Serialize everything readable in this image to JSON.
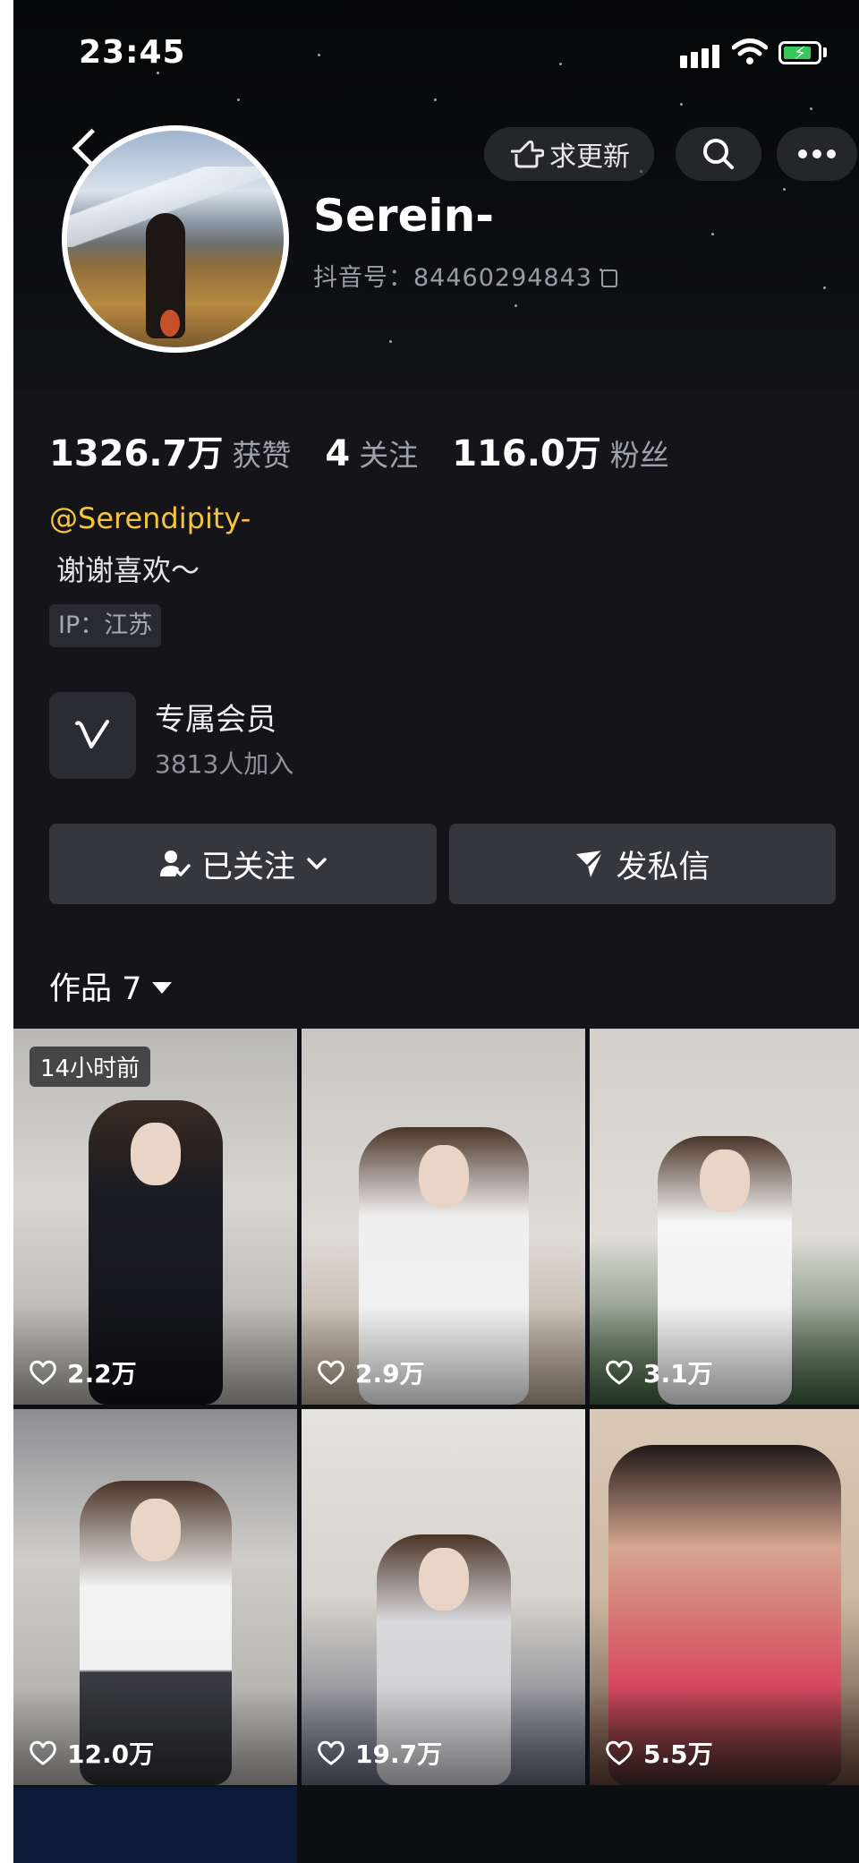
{
  "status_bar": {
    "time": "23:45"
  },
  "header": {
    "update_label": "求更新",
    "name": "Serein-",
    "douyin_id_label": "抖音号：",
    "douyin_id": "84460294843"
  },
  "stats": [
    {
      "value": "1326.7万",
      "label": "获赞"
    },
    {
      "value": "4",
      "label": "关注"
    },
    {
      "value": "116.0万",
      "label": "粉丝"
    }
  ],
  "profile": {
    "handle": "@Serendipity-",
    "bio": "谢谢喜欢～",
    "ip": "IP：江苏"
  },
  "membership": {
    "title": "专属会员",
    "subtitle": "3813人加入"
  },
  "actions": {
    "follow_label": "已关注",
    "message_label": "发私信"
  },
  "works_tab": {
    "label": "作品 7"
  },
  "videos": [
    {
      "likes": "2.2万",
      "badge": "14小时前"
    },
    {
      "likes": "2.9万"
    },
    {
      "likes": "3.1万"
    },
    {
      "likes": "12.0万"
    },
    {
      "likes": "19.7万"
    },
    {
      "likes": "5.5万"
    }
  ],
  "colors": {
    "background": "#151519",
    "accent_handle": "#f5c540",
    "button": "#36373c",
    "battery": "#36c85a"
  }
}
